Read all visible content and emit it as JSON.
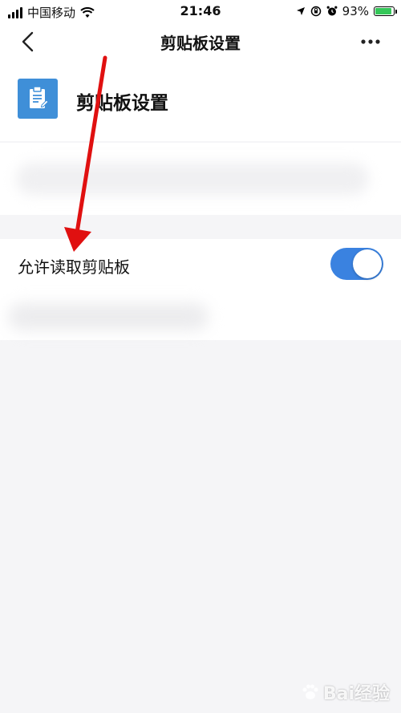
{
  "status_bar": {
    "carrier": "中国移动",
    "time": "21:46",
    "battery_percent": "93%",
    "battery_level": 0.93,
    "icons": [
      "signal-icon",
      "wifi-icon",
      "location-icon",
      "orientation-lock-icon",
      "alarm-icon",
      "battery-icon"
    ]
  },
  "nav": {
    "back_icon": "chevron-left-icon",
    "title": "剪贴板设置",
    "more_icon": "more-dots-icon"
  },
  "app": {
    "icon": "clipboard-icon",
    "icon_color": "#3f8fd8",
    "title": "剪贴板设置"
  },
  "settings": [
    {
      "label": "允许读取剪贴板",
      "enabled": true,
      "toggle_color": "#3a82e0"
    }
  ],
  "annotation": {
    "type": "red-arrow",
    "color": "#e01010"
  },
  "watermark": {
    "text": "Bai经验"
  }
}
